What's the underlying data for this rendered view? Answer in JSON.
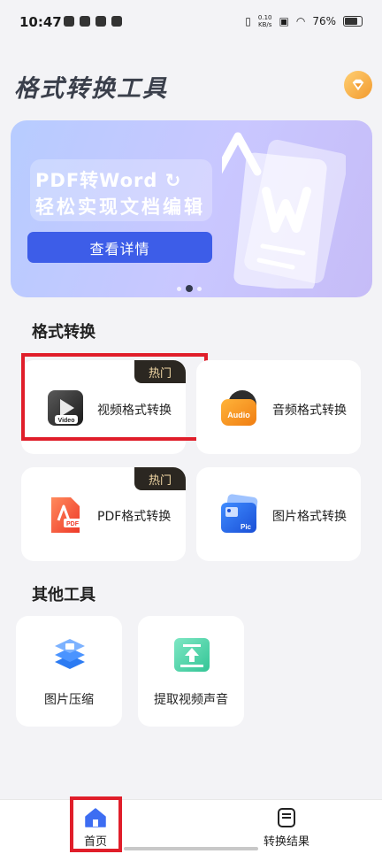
{
  "status": {
    "time": "10:47",
    "net_speed": "0.10",
    "net_unit": "KB/s",
    "battery": "76%"
  },
  "header": {
    "title": "格式转换工具"
  },
  "banner": {
    "line1": "PDF转Word ↻",
    "line2": "轻松实现文档编辑",
    "button": "查看详情"
  },
  "sections": {
    "convert": "格式转换",
    "other": "其他工具"
  },
  "convert_cards": [
    {
      "label": "视频格式转换",
      "badge": "热门",
      "icon": "video-file-icon",
      "icon_text": "Video"
    },
    {
      "label": "音频格式转换",
      "icon": "audio-file-icon",
      "icon_text": "Audio"
    },
    {
      "label": "PDF格式转换",
      "badge": "热门",
      "icon": "pdf-file-icon",
      "icon_text": "PDF"
    },
    {
      "label": "图片格式转换",
      "icon": "picture-file-icon",
      "icon_text": "Pic"
    }
  ],
  "tools": [
    {
      "label": "图片压缩",
      "icon": "image-compress-icon"
    },
    {
      "label": "提取视频声音",
      "icon": "extract-audio-icon"
    }
  ],
  "nav": [
    {
      "label": "首页",
      "icon": "home-icon",
      "active": true
    },
    {
      "label": "转换结果",
      "icon": "document-list-icon",
      "active": false
    }
  ],
  "colors": {
    "accent_blue": "#3d5de8",
    "highlight_red": "#e01e2a",
    "vip_orange": "#f29a2e"
  }
}
